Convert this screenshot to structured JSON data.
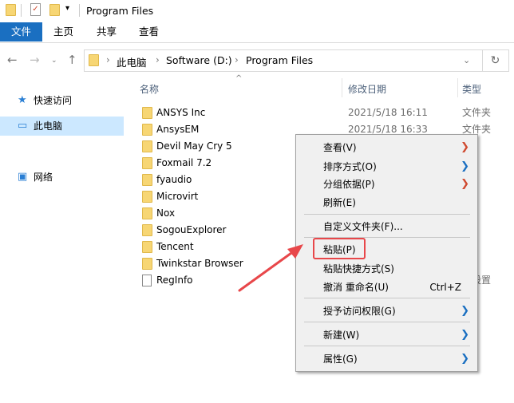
{
  "window": {
    "title": "Program Files"
  },
  "ribbon": {
    "tabs": [
      "文件",
      "主页",
      "共享",
      "查看"
    ]
  },
  "address": {
    "crumbs": [
      "此电脑",
      "Software (D:)",
      "Program Files"
    ]
  },
  "columns": {
    "name": "名称",
    "date": "修改日期",
    "type": "类型"
  },
  "sidebar": {
    "items": [
      {
        "label": "快速访问",
        "icon": "star-icon"
      },
      {
        "label": "此电脑",
        "icon": "computer-icon",
        "selected": true
      },
      {
        "label": "网络",
        "icon": "network-icon"
      }
    ]
  },
  "files": [
    {
      "name": "ANSYS Inc",
      "date": "2021/5/18 16:11",
      "type": "文件夹"
    },
    {
      "name": "AnsysEM",
      "date": "2021/5/18 16:33",
      "type": "文件夹"
    },
    {
      "name": "Devil May Cry 5",
      "date": "",
      "type": "夹"
    },
    {
      "name": "Foxmail 7.2",
      "date": "",
      "type": "夹"
    },
    {
      "name": "fyaudio",
      "date": "",
      "type": "夹"
    },
    {
      "name": "Microvirt",
      "date": "",
      "type": "夹"
    },
    {
      "name": "Nox",
      "date": "",
      "type": "夹"
    },
    {
      "name": "SogouExplorer",
      "date": "",
      "type": "夹"
    },
    {
      "name": "Tencent",
      "date": "",
      "type": "夹"
    },
    {
      "name": "Twinkstar Browser",
      "date": "",
      "type": "夹"
    },
    {
      "name": "RegInfo",
      "date": "",
      "type": "置设置"
    }
  ],
  "context_menu": {
    "items": [
      {
        "label": "查看(V)",
        "submenu": true
      },
      {
        "label": "排序方式(O)",
        "submenu": true
      },
      {
        "label": "分组依据(P)",
        "submenu": true
      },
      {
        "label": "刷新(E)"
      },
      {
        "label": "自定义文件夹(F)..."
      },
      {
        "label": "粘贴(P)",
        "highlighted": true
      },
      {
        "label": "粘贴快捷方式(S)"
      },
      {
        "label": "撤消 重命名(U)",
        "shortcut": "Ctrl+Z"
      },
      {
        "label": "授予访问权限(G)",
        "submenu": true
      },
      {
        "label": "新建(W)",
        "submenu": true
      },
      {
        "label": "属性(G)",
        "submenu": true
      }
    ]
  },
  "colors": {
    "accent": "#1a6fc1",
    "annotation": "#e8474a",
    "selection": "#cce8ff"
  }
}
